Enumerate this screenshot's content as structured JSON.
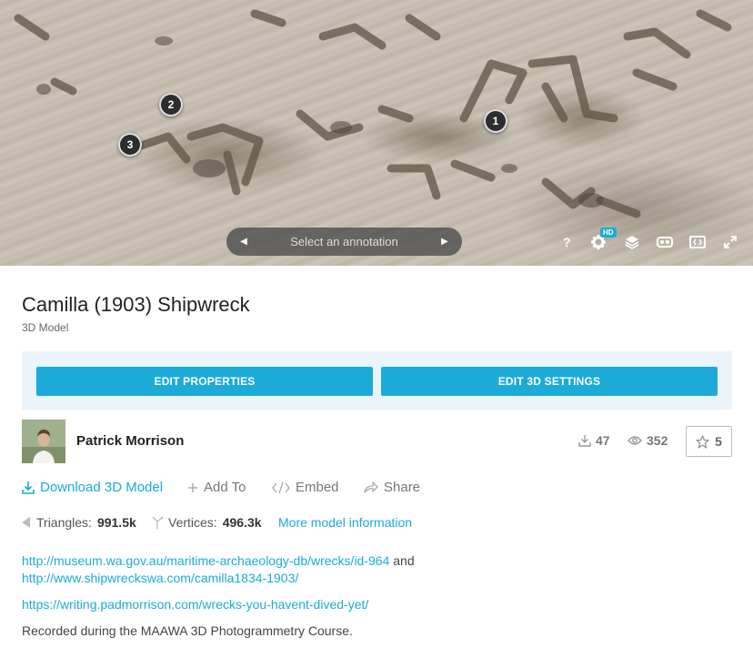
{
  "viewer": {
    "annotations": [
      {
        "number": "1"
      },
      {
        "number": "2"
      },
      {
        "number": "3"
      }
    ],
    "annotation_nav": {
      "label": "Select an annotation"
    },
    "hd_badge": "HD",
    "tools": [
      "help-icon",
      "settings-icon",
      "layers-icon",
      "vr-icon",
      "embed-icon",
      "fullscreen-icon"
    ]
  },
  "model": {
    "title": "Camilla (1903) Shipwreck",
    "type": "3D Model"
  },
  "edit": {
    "properties_label": "EDIT PROPERTIES",
    "settings_label": "EDIT 3D SETTINGS"
  },
  "author": {
    "name": "Patrick Morrison"
  },
  "stats": {
    "downloads": "47",
    "views": "352",
    "likes": "5"
  },
  "actions": {
    "download": "Download 3D Model",
    "add_to": "Add To",
    "embed": "Embed",
    "share": "Share"
  },
  "meta": {
    "triangles_label": "Triangles:",
    "triangles": "991.5k",
    "vertices_label": "Vertices:",
    "vertices": "496.3k",
    "more_info": "More model information"
  },
  "description": {
    "link1": "http://museum.wa.gov.au/maritime-archaeology-db/wrecks/id-964",
    "and": "and",
    "link2": "http://www.shipwreckswa.com/camilla1834-1903/",
    "link3": "https://writing.padmorrison.com/wrecks-you-havent-dived-yet/",
    "text": "Recorded during the MAAWA 3D Photogrammetry Course."
  },
  "colors": {
    "accent": "#1caad9",
    "panel_bg": "#eaf4fa"
  }
}
